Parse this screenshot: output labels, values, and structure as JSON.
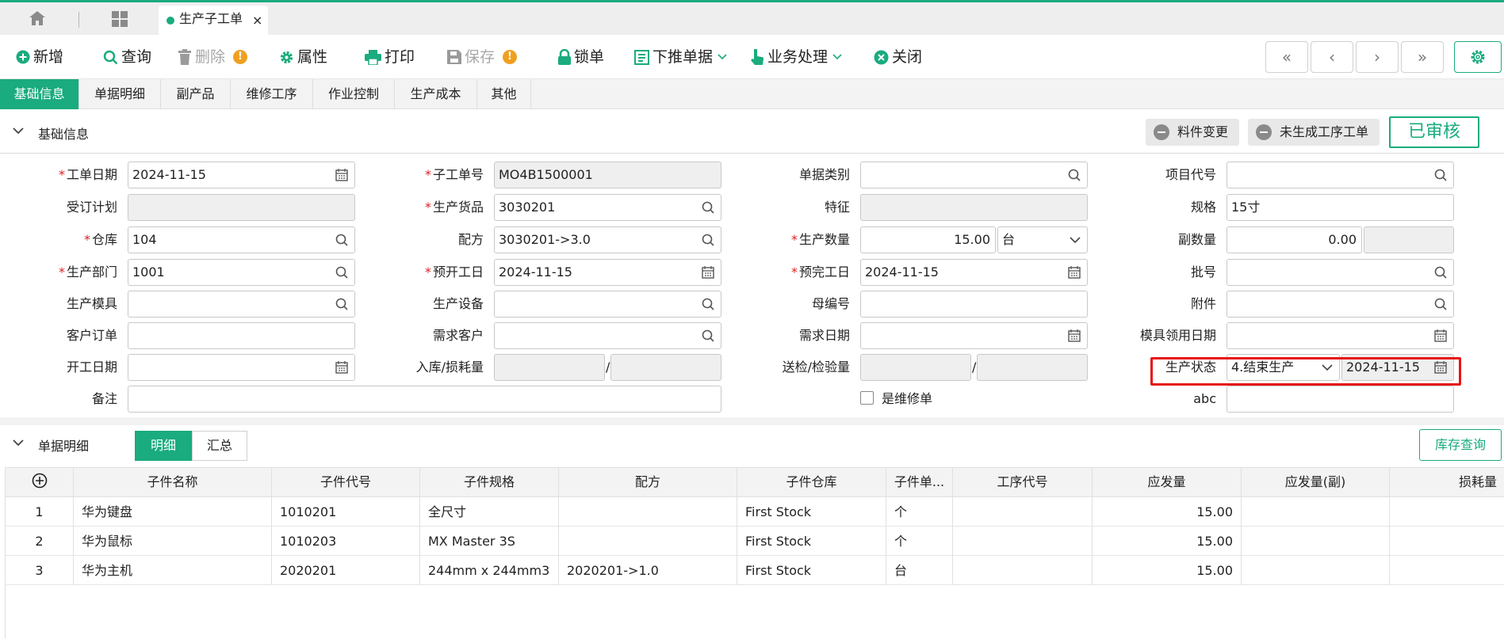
{
  "tabs": {
    "active_tab": "生产子工单",
    "close_glyph": "×"
  },
  "toolbar": {
    "new": "新增",
    "query": "查询",
    "delete": "删除",
    "warn_glyph": "!",
    "properties": "属性",
    "print": "打印",
    "save": "保存",
    "lock": "锁单",
    "push_down": "下推单据",
    "business": "业务处理",
    "close": "关闭",
    "nav": [
      "«",
      "‹",
      "›",
      "»"
    ]
  },
  "subtabs": [
    "基础信息",
    "单据明细",
    "副产品",
    "维修工序",
    "作业控制",
    "生产成本",
    "其他"
  ],
  "basic": {
    "section_title": "基础信息",
    "chip_material_change": "料件变更",
    "chip_no_process": "未生成工序工单",
    "approved": "已审核",
    "fields": {
      "work_date": {
        "label": "工单日期",
        "value": "2024-11-15"
      },
      "sub_order_no": {
        "label": "子工单号",
        "value": "MO4B1500001"
      },
      "doc_type": {
        "label": "单据类别",
        "value": ""
      },
      "project_code": {
        "label": "项目代号",
        "value": ""
      },
      "order_plan": {
        "label": "受订计划",
        "value": ""
      },
      "product": {
        "label": "生产货品",
        "value": "3030201"
      },
      "feature": {
        "label": "特征",
        "value": ""
      },
      "spec": {
        "label": "规格",
        "value": "15寸"
      },
      "warehouse": {
        "label": "仓库",
        "value": "104"
      },
      "formula": {
        "label": "配方",
        "value": "3030201->3.0"
      },
      "qty": {
        "label": "生产数量",
        "value": "15.00",
        "unit": "台"
      },
      "sub_qty": {
        "label": "副数量",
        "value": "0.00"
      },
      "dept": {
        "label": "生产部门",
        "value": "1001"
      },
      "plan_start": {
        "label": "预开工日",
        "value": "2024-11-15"
      },
      "plan_end": {
        "label": "预完工日",
        "value": "2024-11-15"
      },
      "batch": {
        "label": "批号",
        "value": ""
      },
      "mold": {
        "label": "生产模具",
        "value": ""
      },
      "equipment": {
        "label": "生产设备",
        "value": ""
      },
      "parent_no": {
        "label": "母编号",
        "value": ""
      },
      "attachment": {
        "label": "附件",
        "value": ""
      },
      "customer_order": {
        "label": "客户订单",
        "value": ""
      },
      "demand_customer": {
        "label": "需求客户",
        "value": ""
      },
      "demand_date": {
        "label": "需求日期",
        "value": ""
      },
      "mold_use_date": {
        "label": "模具领用日期",
        "value": ""
      },
      "start_date": {
        "label": "开工日期",
        "value": ""
      },
      "inbound_loss": {
        "label": "入库/损耗量",
        "value1": "",
        "value2": ""
      },
      "inspect_qty": {
        "label": "送检/检验量",
        "value1": "",
        "value2": ""
      },
      "prod_status": {
        "label": "生产状态",
        "value": "4.结束生产",
        "date": "2024-11-15"
      },
      "remark": {
        "label": "备注",
        "value": ""
      },
      "is_repair": {
        "label": "是维修单"
      },
      "abc": {
        "label": "abc",
        "value": ""
      }
    }
  },
  "detail": {
    "section_title": "单据明细",
    "seg_detail": "明细",
    "seg_summary": "汇总",
    "stock_query": "库存查询",
    "add_glyph": "+",
    "columns": [
      "子件名称",
      "子件代号",
      "子件规格",
      "配方",
      "子件仓库",
      "子件单...",
      "工序代号",
      "应发量",
      "应发量(副)",
      "损耗量"
    ],
    "rows": [
      {
        "no": "1",
        "name": "华为键盘",
        "code": "1010201",
        "spec": "全尺寸",
        "formula": "",
        "wh": "First Stock",
        "unit": "个",
        "proc": "",
        "qty": "15.00",
        "qty2": "",
        "loss": ""
      },
      {
        "no": "2",
        "name": "华为鼠标",
        "code": "1010203",
        "spec": "MX Master 3S",
        "formula": "",
        "wh": "First Stock",
        "unit": "个",
        "proc": "",
        "qty": "15.00",
        "qty2": "",
        "loss": ""
      },
      {
        "no": "3",
        "name": "华为主机",
        "code": "2020201",
        "spec": "244mm x 244mm3",
        "formula": "2020201->1.0",
        "wh": "First Stock",
        "unit": "台",
        "proc": "",
        "qty": "15.00",
        "qty2": "",
        "loss": ""
      }
    ]
  },
  "colors": {
    "accent": "#1aab7e",
    "highlight": "#e81414",
    "warning": "#f0a020"
  }
}
